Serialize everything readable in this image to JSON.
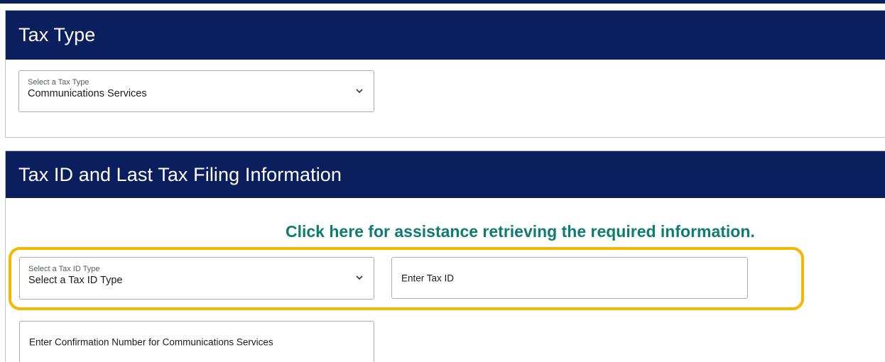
{
  "tax_type_section": {
    "title": "Tax Type",
    "select": {
      "label": "Select a Tax Type",
      "value": "Communications Services"
    }
  },
  "tax_id_section": {
    "title": "Tax ID and Last Tax Filing Information",
    "help_link": "Click here for assistance retrieving the required information.",
    "tax_id_type_select": {
      "label": "Select a Tax ID Type",
      "value": "Select a Tax ID Type"
    },
    "tax_id_input": {
      "placeholder": "Enter Tax ID"
    },
    "confirmation_input": {
      "placeholder": "Enter Confirmation Number for Communications Services"
    }
  },
  "colors": {
    "header_bg": "#0b1f5f",
    "help_link": "#0e7c73",
    "highlight": "#f5b700"
  },
  "icons": {
    "select_chevron": "chevron-down-icon"
  }
}
